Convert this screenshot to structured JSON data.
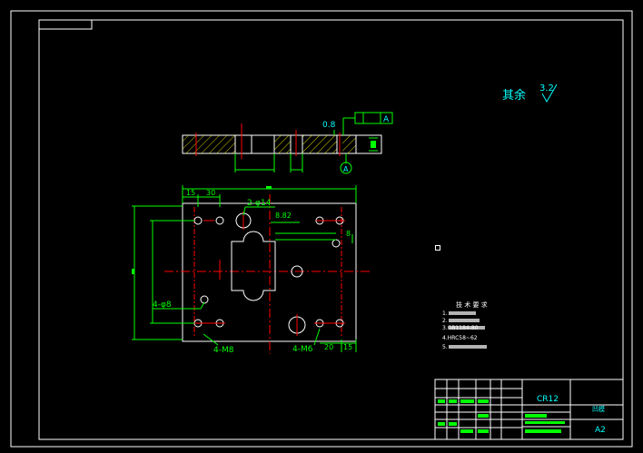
{
  "drawing": {
    "surface_note": "其余",
    "surface_value": "3.2",
    "material": "CR12",
    "scale_cell": "A2",
    "title_small": "凹模",
    "notes_heading": "技 术 要 求",
    "notes": [
      "1.",
      "2.",
      "3.GB1184-80",
      "4.HRC58~62",
      "5."
    ],
    "labels": {
      "flatness_tol": "0.8",
      "parallel_ref": "A",
      "datum": "A",
      "holes_top": "2-φ14",
      "holes_left": "4-φ8",
      "thread_left": "4-M8",
      "thread_right": "4-M6",
      "dim_15": "15",
      "dim_30": "30",
      "dim_20": "20",
      "dim_15b": "15",
      "dim_8": "8",
      "dim_882": "8.82"
    }
  },
  "colors": {
    "frame": "#ffffff",
    "outline": "#ffffff",
    "dimension": "#00ff00",
    "centerline": "#ff0000",
    "text": "#00ffff",
    "hatch": "#ffff00"
  }
}
